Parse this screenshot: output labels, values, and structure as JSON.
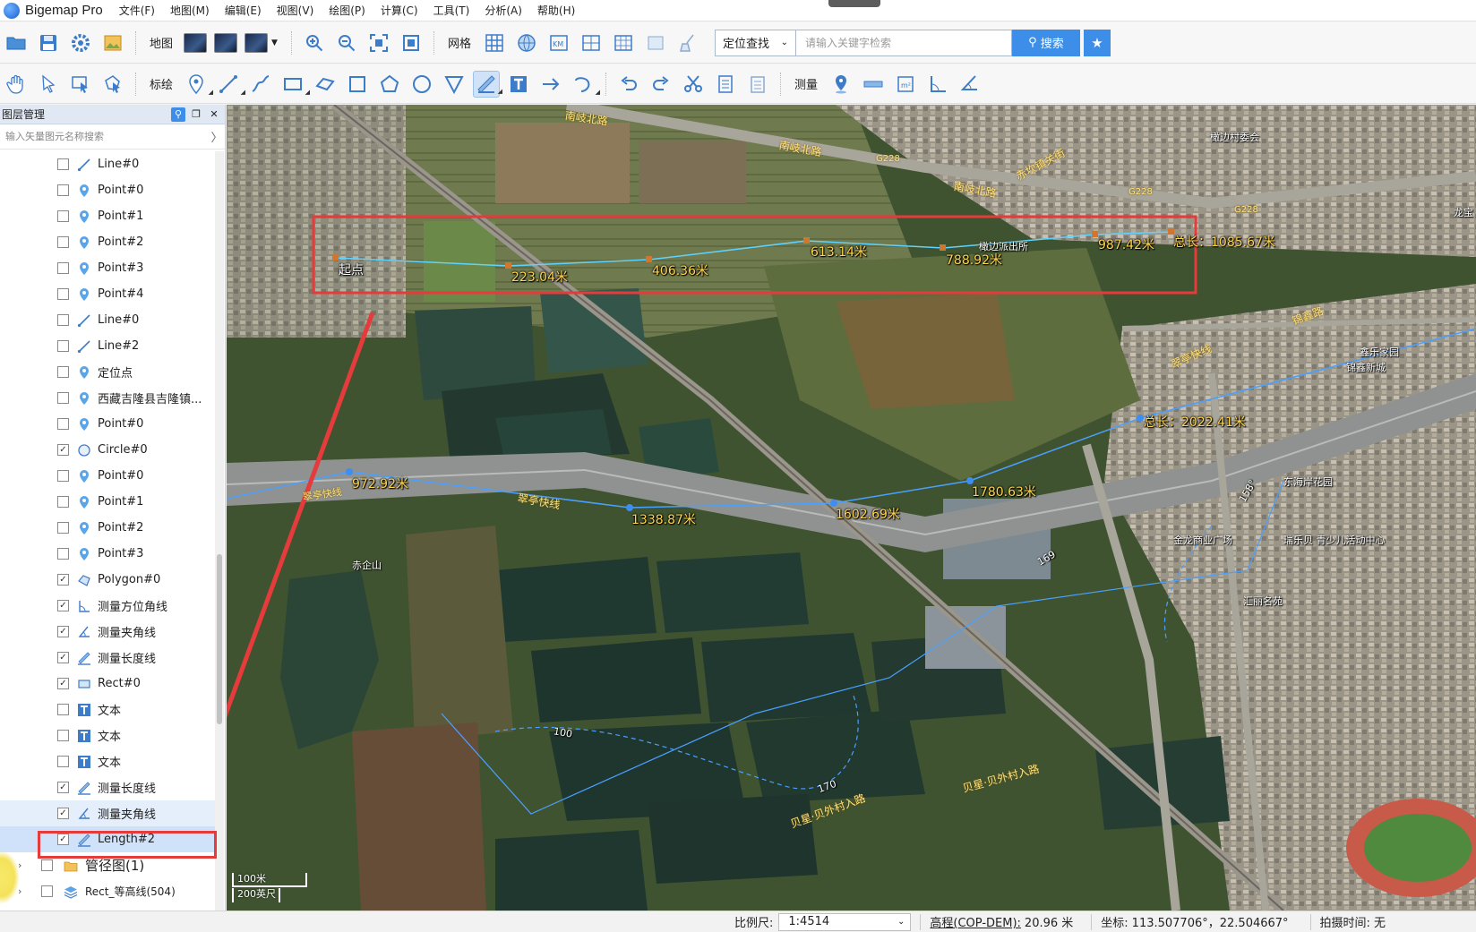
{
  "app": {
    "title": "Bigemap Pro"
  },
  "menu": [
    "文件(F)",
    "地图(M)",
    "编辑(E)",
    "视图(V)",
    "绘图(P)",
    "计算(C)",
    "工具(T)",
    "分析(A)",
    "帮助(H)"
  ],
  "toolbar1": {
    "map_label": "地图",
    "grid_label": "网格",
    "search": {
      "type": "定位查找",
      "placeholder": "请输入关键字检索",
      "button": "搜索"
    }
  },
  "toolbar2": {
    "annotate_label": "标绘",
    "measure_label": "测量"
  },
  "panel": {
    "title": "图层管理",
    "search_placeholder": "输入矢量图元名称搜索",
    "items": [
      {
        "label": "Line#0",
        "checked": false,
        "icon": "line"
      },
      {
        "label": "Point#0",
        "checked": false,
        "icon": "point"
      },
      {
        "label": "Point#1",
        "checked": false,
        "icon": "point"
      },
      {
        "label": "Point#2",
        "checked": false,
        "icon": "point"
      },
      {
        "label": "Point#3",
        "checked": false,
        "icon": "point"
      },
      {
        "label": "Point#4",
        "checked": false,
        "icon": "point"
      },
      {
        "label": "Line#0",
        "checked": false,
        "icon": "line"
      },
      {
        "label": "Line#2",
        "checked": false,
        "icon": "line"
      },
      {
        "label": "定位点",
        "checked": false,
        "icon": "point"
      },
      {
        "label": "西藏吉隆县吉隆镇...",
        "checked": false,
        "icon": "point"
      },
      {
        "label": "Point#0",
        "checked": false,
        "icon": "point"
      },
      {
        "label": "Circle#0",
        "checked": true,
        "icon": "circle"
      },
      {
        "label": "Point#0",
        "checked": false,
        "icon": "point"
      },
      {
        "label": "Point#1",
        "checked": false,
        "icon": "point"
      },
      {
        "label": "Point#2",
        "checked": false,
        "icon": "point"
      },
      {
        "label": "Point#3",
        "checked": false,
        "icon": "point"
      },
      {
        "label": "Polygon#0",
        "checked": true,
        "icon": "polygon"
      },
      {
        "label": "测量方位角线",
        "checked": true,
        "icon": "azimuth"
      },
      {
        "label": "测量夹角线",
        "checked": true,
        "icon": "angle"
      },
      {
        "label": "测量长度线",
        "checked": true,
        "icon": "length"
      },
      {
        "label": "Rect#0",
        "checked": true,
        "icon": "rect"
      },
      {
        "label": "文本",
        "checked": false,
        "icon": "text"
      },
      {
        "label": "文本",
        "checked": false,
        "icon": "text"
      },
      {
        "label": "文本",
        "checked": false,
        "icon": "text"
      },
      {
        "label": "测量长度线",
        "checked": true,
        "icon": "length"
      },
      {
        "label": "测量夹角线",
        "checked": true,
        "icon": "angle"
      },
      {
        "label": "Length#2",
        "checked": true,
        "icon": "length"
      }
    ],
    "groups": [
      {
        "label": "管径图(1)",
        "icon": "folder"
      },
      {
        "label": "Rect_等高线(504)",
        "icon": "layers"
      }
    ]
  },
  "map": {
    "measure_top": [
      "起点",
      "223.04米",
      "406.36米",
      "613.14米",
      "788.92米",
      "987.42米",
      "总长：1085.67米"
    ],
    "measure_road": [
      "972.92米",
      "1338.87米",
      "1602.69米",
      "1780.63米",
      "总长：2022.41米"
    ],
    "angle_labels": [
      "158°",
      "169",
      "100",
      "170"
    ],
    "roads": [
      "南岐北路",
      "南岐北路",
      "南岐北路",
      "赤坎镇关街",
      "G228",
      "G228",
      "G228",
      "翠亭快线",
      "翠亭快线",
      "贝星·贝外村入路",
      "贝星·贝外村入路",
      "锦鑫路",
      "翠亭快线"
    ],
    "pois": [
      "橄边村委会",
      "橄边派出所",
      "赤企山",
      "金龙商业广场",
      "瑞乐贝 青少儿活动中心",
      "锦鑫新城",
      "东海岸花园",
      "汇丽名苑",
      "鑫乐家园",
      "龙宝"
    ],
    "scale": {
      "top": "100米",
      "bottom": "200英尺"
    }
  },
  "status": {
    "scale_label": "比例尺:",
    "scale_value": "1:4514",
    "elevation_label": "高程(COP-DEM):",
    "elevation_value": "20.96 米",
    "coord_label": "坐标:",
    "coord_value": "113.507706°，22.504667°",
    "capture_label": "拍摄时间:",
    "capture_value": "无"
  },
  "colors": {
    "accent": "#3c8ee8",
    "highlight": "#e53b3b",
    "measure_line": "#5fd3ff"
  }
}
